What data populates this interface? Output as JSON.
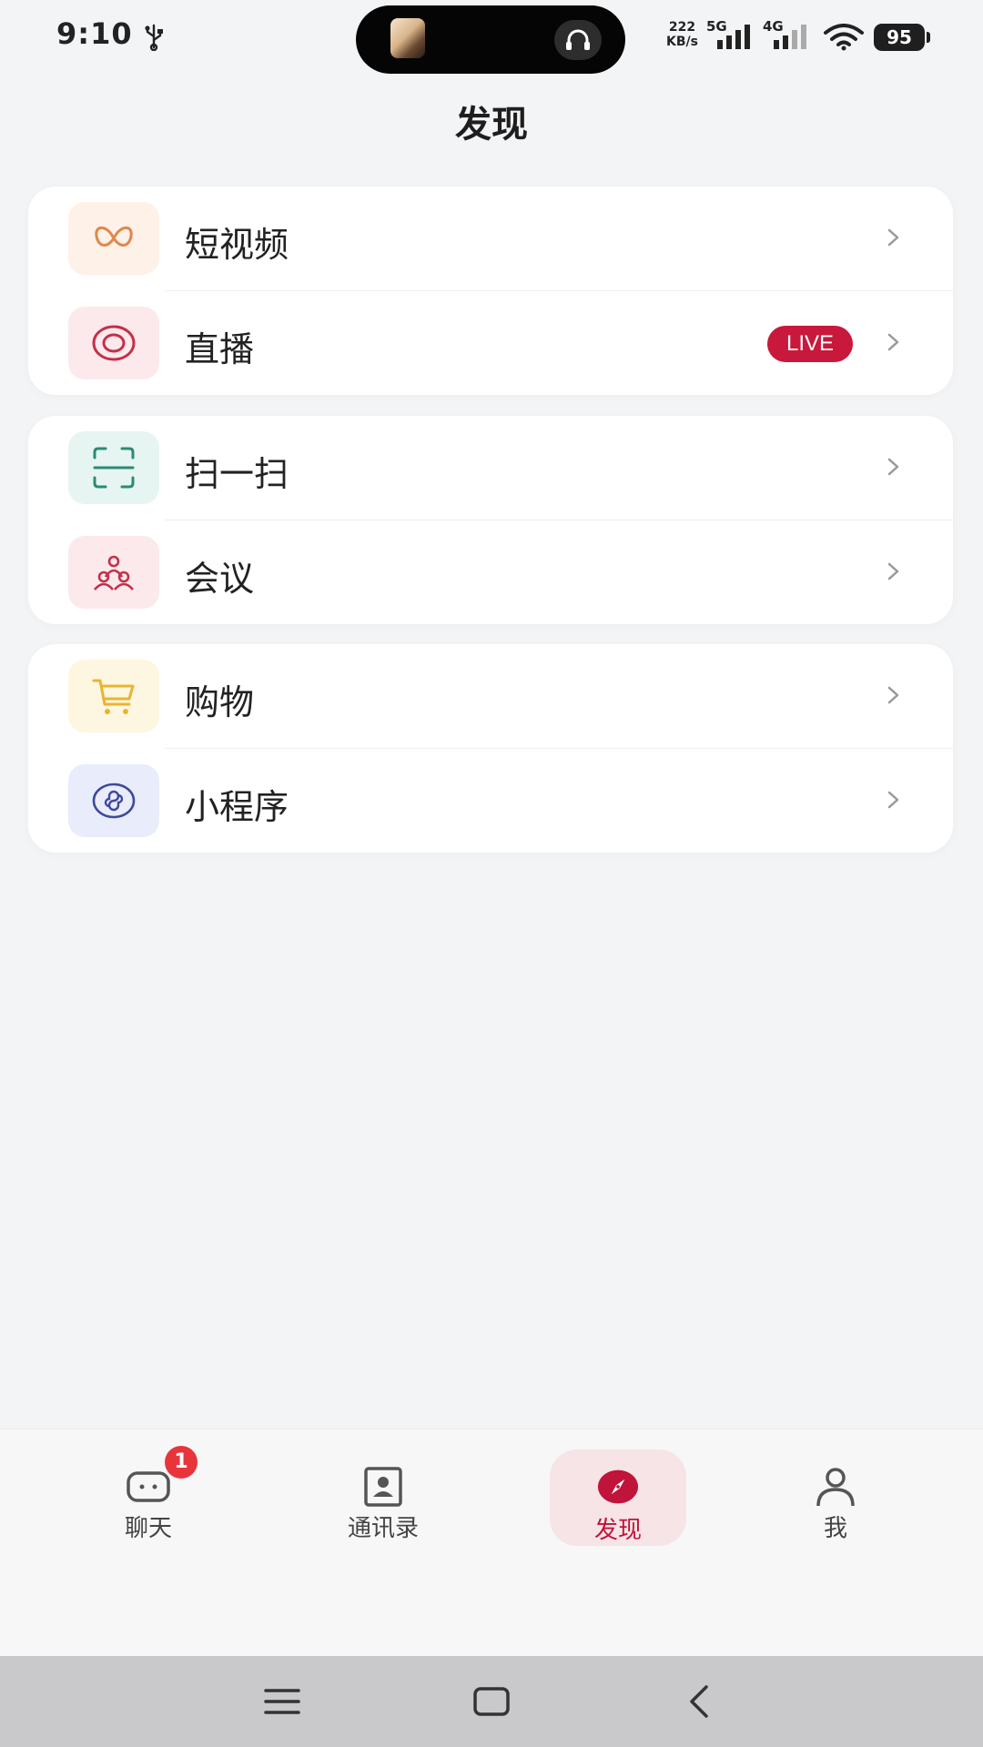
{
  "status_bar": {
    "time": "9:10",
    "net_speed_value": "222",
    "net_speed_unit": "KB/s",
    "sig1_label": "5G",
    "sig2_label": "4G",
    "battery": "95"
  },
  "header": {
    "title": "发现"
  },
  "groups": [
    {
      "items": [
        {
          "label": "短视频",
          "icon": "butterfly-icon",
          "icon_bg": "#fdf1e8",
          "icon_color": "#e0884a"
        },
        {
          "label": "直播",
          "icon": "live-ring-icon",
          "icon_bg": "#fbe9ec",
          "icon_color": "#c4304a",
          "badge": "LIVE"
        }
      ]
    },
    {
      "items": [
        {
          "label": "扫一扫",
          "icon": "scan-icon",
          "icon_bg": "#e6f5f1",
          "icon_color": "#2a8a76"
        },
        {
          "label": "会议",
          "icon": "meeting-icon",
          "icon_bg": "#fbe9ec",
          "icon_color": "#c4304a"
        }
      ]
    },
    {
      "items": [
        {
          "label": "购物",
          "icon": "cart-icon",
          "icon_bg": "#fdf6e0",
          "icon_color": "#e8b530"
        },
        {
          "label": "小程序",
          "icon": "mini-program-icon",
          "icon_bg": "#e9ecfa",
          "icon_color": "#3d4a9a"
        }
      ]
    }
  ],
  "tab_bar": {
    "tabs": [
      {
        "label": "聊天",
        "icon": "chat-icon",
        "badge": "1"
      },
      {
        "label": "通讯录",
        "icon": "contacts-icon"
      },
      {
        "label": "发现",
        "icon": "compass-icon",
        "active": true
      },
      {
        "label": "我",
        "icon": "person-icon"
      }
    ]
  },
  "colors": {
    "accent": "#c0143a",
    "live_badge": "#c8183b",
    "tab_badge": "#e8353c"
  }
}
